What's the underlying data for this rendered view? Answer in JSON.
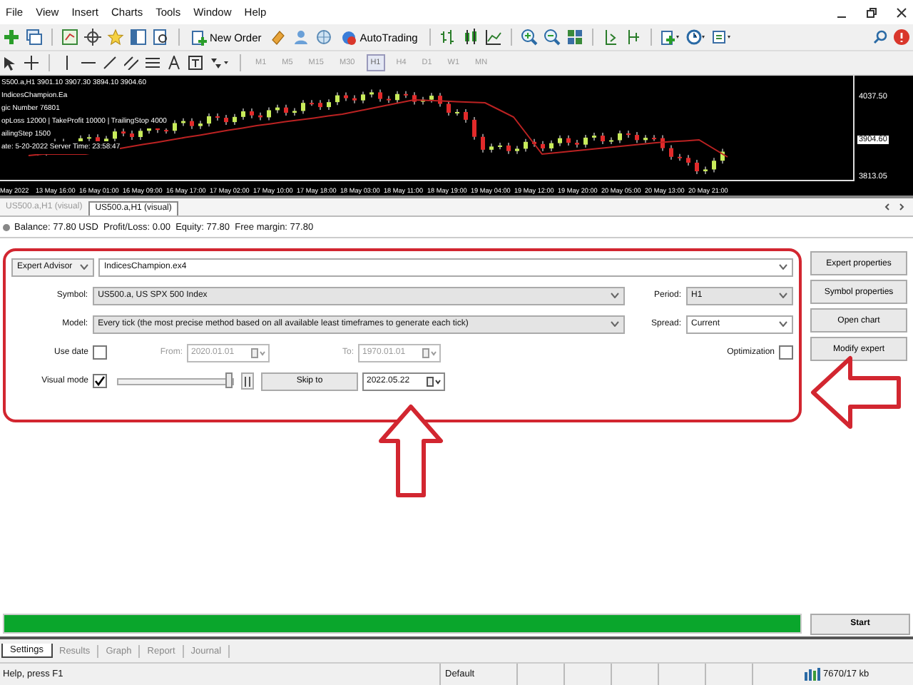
{
  "menu": [
    "File",
    "View",
    "Insert",
    "Charts",
    "Tools",
    "Window",
    "Help"
  ],
  "toolbar": {
    "new_order": "New Order",
    "autotrading": "AutoTrading"
  },
  "timeframes": [
    {
      "label": "M1",
      "selected": false
    },
    {
      "label": "M5",
      "selected": false
    },
    {
      "label": "M15",
      "selected": false
    },
    {
      "label": "M30",
      "selected": false
    },
    {
      "label": "H1",
      "selected": true
    },
    {
      "label": "H4",
      "selected": false
    },
    {
      "label": "D1",
      "selected": false
    },
    {
      "label": "W1",
      "selected": false
    },
    {
      "label": "MN",
      "selected": false
    }
  ],
  "chart": {
    "info_lines": [
      "S500.a,H1  3901.10 3907.30 3894.10 3904.60",
      "IndicesChampion.Ea",
      "gic Number 76801",
      "opLoss 12000 | TakeProfit 10000 | TrailingStop 4000",
      "ailingStep 1500",
      "ate: 5-20-2022 Server Time: 23:58:47"
    ],
    "price_labels": [
      {
        "label": "4037.50",
        "current": false
      },
      {
        "label": "3904.60",
        "current": true
      },
      {
        "label": "3813.05",
        "current": false
      }
    ],
    "time_labels": [
      "May 2022",
      "13 May 16:00",
      "16 May 01:00",
      "16 May 09:00",
      "16 May 17:00",
      "17 May 02:00",
      "17 May 10:00",
      "17 May 18:00",
      "18 May 03:00",
      "18 May 11:00",
      "18 May 19:00",
      "19 May 04:00",
      "19 May 12:00",
      "19 May 20:00",
      "20 May 05:00",
      "20 May 13:00",
      "20 May 21:00"
    ]
  },
  "chart_tabs": [
    {
      "label": "US500.a,H1 (visual)",
      "selected": false
    },
    {
      "label": "US500.a,H1 (visual)",
      "selected": true
    }
  ],
  "account_line": "Balance: 77.80 USD  Profit/Loss: 0.00  Equity: 77.80  Free margin: 77.80",
  "tester": {
    "type_select": "Expert Advisor",
    "expert_file": "IndicesChampion.ex4",
    "symbol_label": "Symbol:",
    "symbol": "US500.a, US SPX 500 Index",
    "model_label": "Model:",
    "model": "Every tick (the most precise method based on all available least timeframes to generate each tick)",
    "use_date_label": "Use date",
    "use_date": false,
    "from_label": "From:",
    "from": "2020.01.01",
    "to_label": "To:",
    "to": "1970.01.01",
    "visual_mode_label": "Visual mode",
    "visual_mode": true,
    "speed": {
      "level": 1
    },
    "skip_to": "Skip to",
    "skip_date": "2022.05.22",
    "period_label": "Period:",
    "period": "H1",
    "spread_label": "Spread:",
    "spread": "Current",
    "optimization_label": "Optimization",
    "optimization": false,
    "buttons": [
      "Expert properties",
      "Symbol properties",
      "Open chart",
      "Modify expert"
    ],
    "progress": {
      "level": 1
    },
    "start": "Start"
  },
  "bottom_tabs": [
    {
      "label": "Settings",
      "selected": true
    },
    {
      "label": "Results",
      "selected": false
    },
    {
      "label": "Graph",
      "selected": false
    },
    {
      "label": "Report",
      "selected": false
    },
    {
      "label": "Journal",
      "selected": false
    }
  ],
  "status_bar": {
    "help": "Help, press F1",
    "profile": "Default",
    "traffic": "7670/17 kb"
  }
}
